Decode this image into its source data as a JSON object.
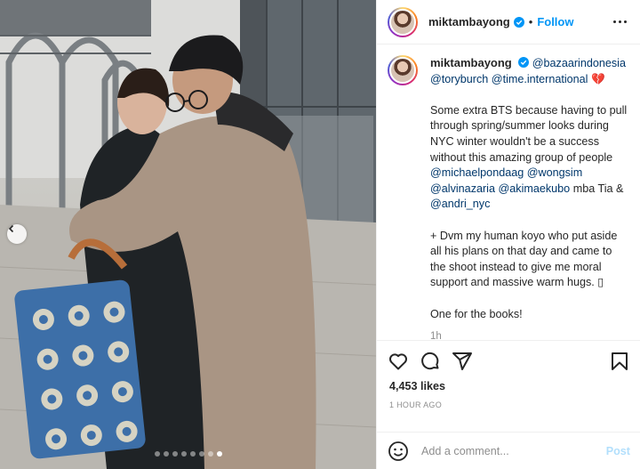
{
  "post": {
    "username": "miktambayong",
    "follow_label": "Follow",
    "separator": "•",
    "icons": [
      "verified-badge-icon",
      "more-options-icon",
      "prev-image-icon",
      "heart-icon",
      "comment-icon",
      "share-icon",
      "bookmark-icon",
      "emoji-icon"
    ],
    "carousel": {
      "total": 8,
      "active_index": 7
    }
  },
  "caption": {
    "username": "miktambayong",
    "line1_mentions": [
      "@bazaarindonesia",
      "@toryburch",
      "@time.international"
    ],
    "line1_emoji": "💔",
    "para2_text": "Some extra BTS because having to pull through spring/summer looks during NYC winter wouldn't be a success without this amazing group of people",
    "para2_mentions": [
      "@michaelpondaag",
      "@wongsim",
      "@alvinazaria",
      "@akimaekubo"
    ],
    "para2_tail": "mba Tia &",
    "para2_last_mention": "@andri_nyc",
    "para3_text": "+ Dvm my human koyo who put aside all his plans on that day and came to the shoot instead to give me moral support and massive warm hugs. ▯",
    "para4_text": "One for the books!",
    "time": "1h"
  },
  "stats": {
    "likes": "4,453 likes",
    "age": "1 HOUR AGO"
  },
  "comment": {
    "placeholder": "Add a comment...",
    "post_label": "Post"
  },
  "colors": {
    "link_blue": "#0095f6",
    "mention": "#00376b",
    "muted": "#8e8e8e",
    "post_disabled": "#b2dffc"
  }
}
